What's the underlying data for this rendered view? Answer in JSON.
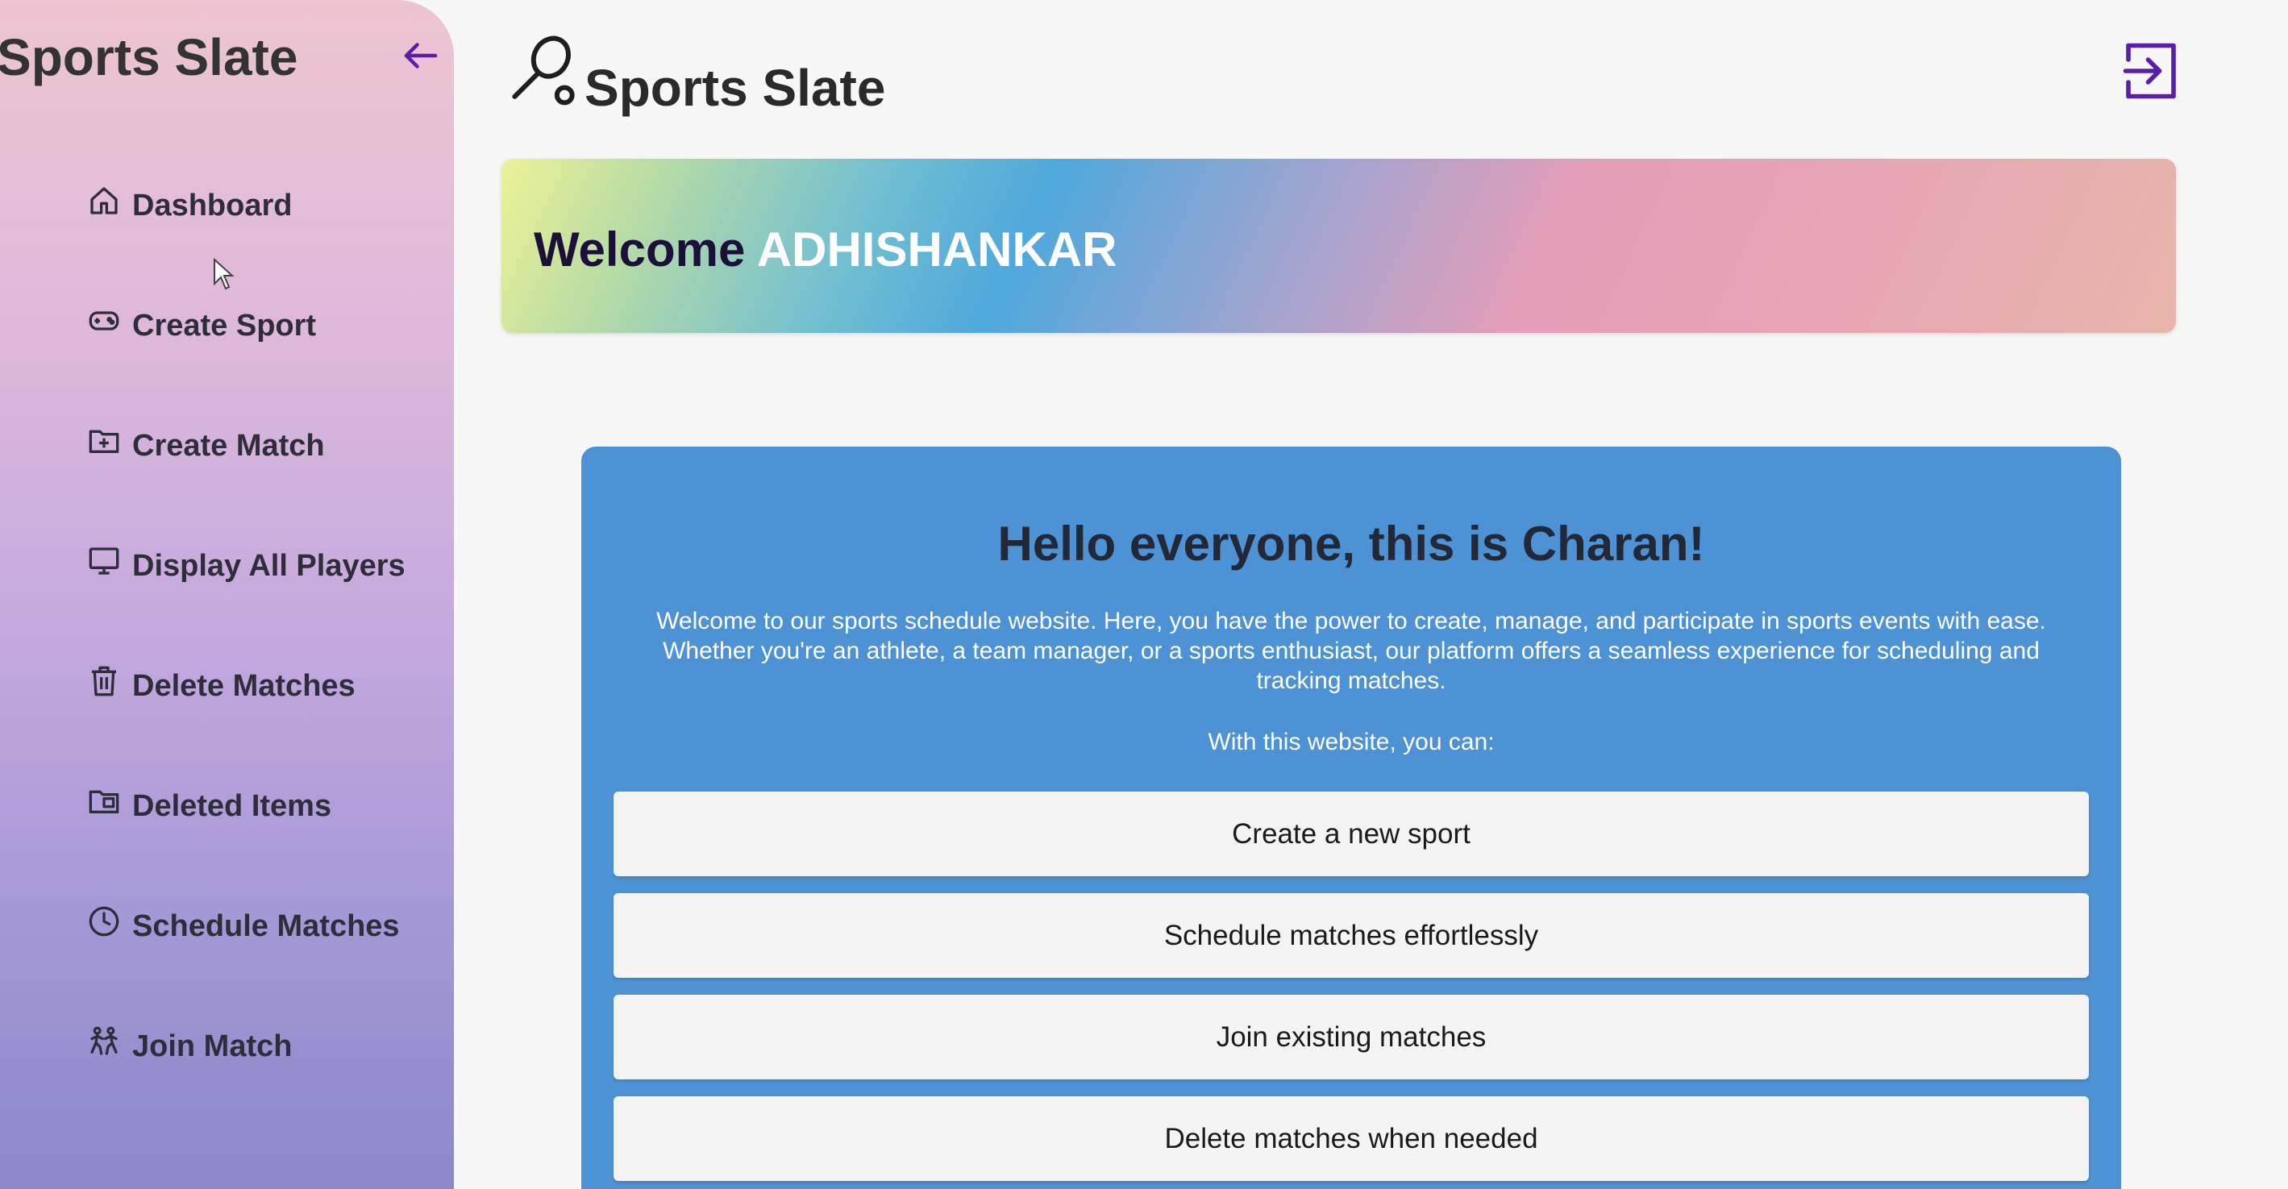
{
  "sidebar": {
    "title": "Sports Slate",
    "back_icon": "arrow-left-icon",
    "items": [
      {
        "label": "Dashboard",
        "icon": "home-icon"
      },
      {
        "label": "Create Sport",
        "icon": "gamepad-icon"
      },
      {
        "label": "Create Match",
        "icon": "folder-plus-icon"
      },
      {
        "label": "Display All Players",
        "icon": "monitor-icon"
      },
      {
        "label": "Delete Matches",
        "icon": "trash-icon"
      },
      {
        "label": "Deleted Items",
        "icon": "folder-image-icon"
      },
      {
        "label": "Schedule Matches",
        "icon": "clock-icon"
      },
      {
        "label": "Join Match",
        "icon": "players-icon"
      }
    ]
  },
  "header": {
    "brand_name": "Sports Slate",
    "brand_icon": "racket-icon",
    "logout_icon": "logout-icon"
  },
  "welcome": {
    "prefix": "Welcome",
    "username": "ADHISHANKAR"
  },
  "card": {
    "heading": "Hello everyone, this is Charan!",
    "description": "Welcome to our sports schedule website. Here, you have the power to create, manage, and participate in sports events with ease. Whether you're an athlete, a team manager, or a sports enthusiast, our platform offers a seamless experience for scheduling and tracking matches.",
    "subheading": "With this website, you can:",
    "features": [
      "Create a new sport",
      "Schedule matches effortlessly",
      "Join existing matches",
      "Delete matches when needed"
    ]
  },
  "colors": {
    "accent": "#5b1ea8",
    "card_blue": "#4d92d4",
    "welcome_prefix": "#1c0f3a"
  }
}
